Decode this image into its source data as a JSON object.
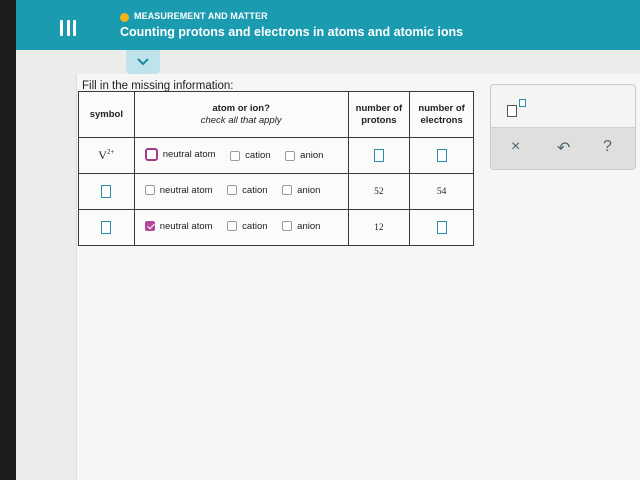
{
  "header": {
    "topic": "MEASUREMENT AND MATTER",
    "title": "Counting protons and electrons in atoms and atomic ions"
  },
  "instruction": "Fill in the missing information:",
  "table": {
    "headers": {
      "symbol": "symbol",
      "atom_or_ion": "atom or ion?",
      "atom_or_ion_sub": "check all that apply",
      "protons": "number of protons",
      "electrons": "number of electrons"
    },
    "option_labels": [
      "neutral atom",
      "cation",
      "anion"
    ],
    "rows": [
      {
        "symbol_base": "V",
        "symbol_charge": "2+",
        "checked": [
          false,
          false,
          false
        ],
        "protons": "",
        "electrons": ""
      },
      {
        "symbol_base": "",
        "symbol_charge": "",
        "checked": [
          false,
          false,
          false
        ],
        "protons": "52",
        "electrons": "54"
      },
      {
        "symbol_base": "",
        "symbol_charge": "",
        "checked": [
          true,
          false,
          false
        ],
        "protons": "12",
        "electrons": ""
      }
    ]
  },
  "tools": {
    "icons": [
      "superscript-icon",
      "close-icon",
      "undo-icon",
      "help-icon"
    ],
    "close_glyph": "×",
    "undo_glyph": "↶",
    "help_glyph": "?"
  },
  "colors": {
    "header": "#1a9bb0",
    "topic_dot": "#f2b31b",
    "checked": "#b3479b",
    "answer_box": "#2a90aa"
  }
}
